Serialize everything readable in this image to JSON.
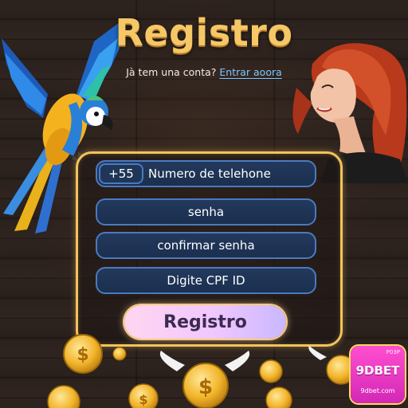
{
  "header": {
    "title": "Registro",
    "account_prompt": "Jà tem una conta?",
    "login_link": "Entrar aoora"
  },
  "form": {
    "phone_prefix": "+55",
    "phone_placeholder": "Numero de telehone",
    "password_placeholder": "senha",
    "confirm_password_placeholder": "confirmar senha",
    "cpf_placeholder": "Digite CPF ID",
    "submit_label": "Registro"
  },
  "badge": {
    "small_text": "P03P",
    "brand": "9DBET",
    "url": "9dbet.com"
  },
  "colors": {
    "title_gold": "#f6c766",
    "panel_border": "#f2c35a",
    "field_bg": "#1b2f4f",
    "field_border": "#4a7ac0",
    "link_blue": "#7cc7ff",
    "badge_pink": "#e033c0"
  },
  "icons": [
    "parrot-illustration",
    "woman-illustration",
    "winged-coin-icon",
    "coin-icon"
  ]
}
